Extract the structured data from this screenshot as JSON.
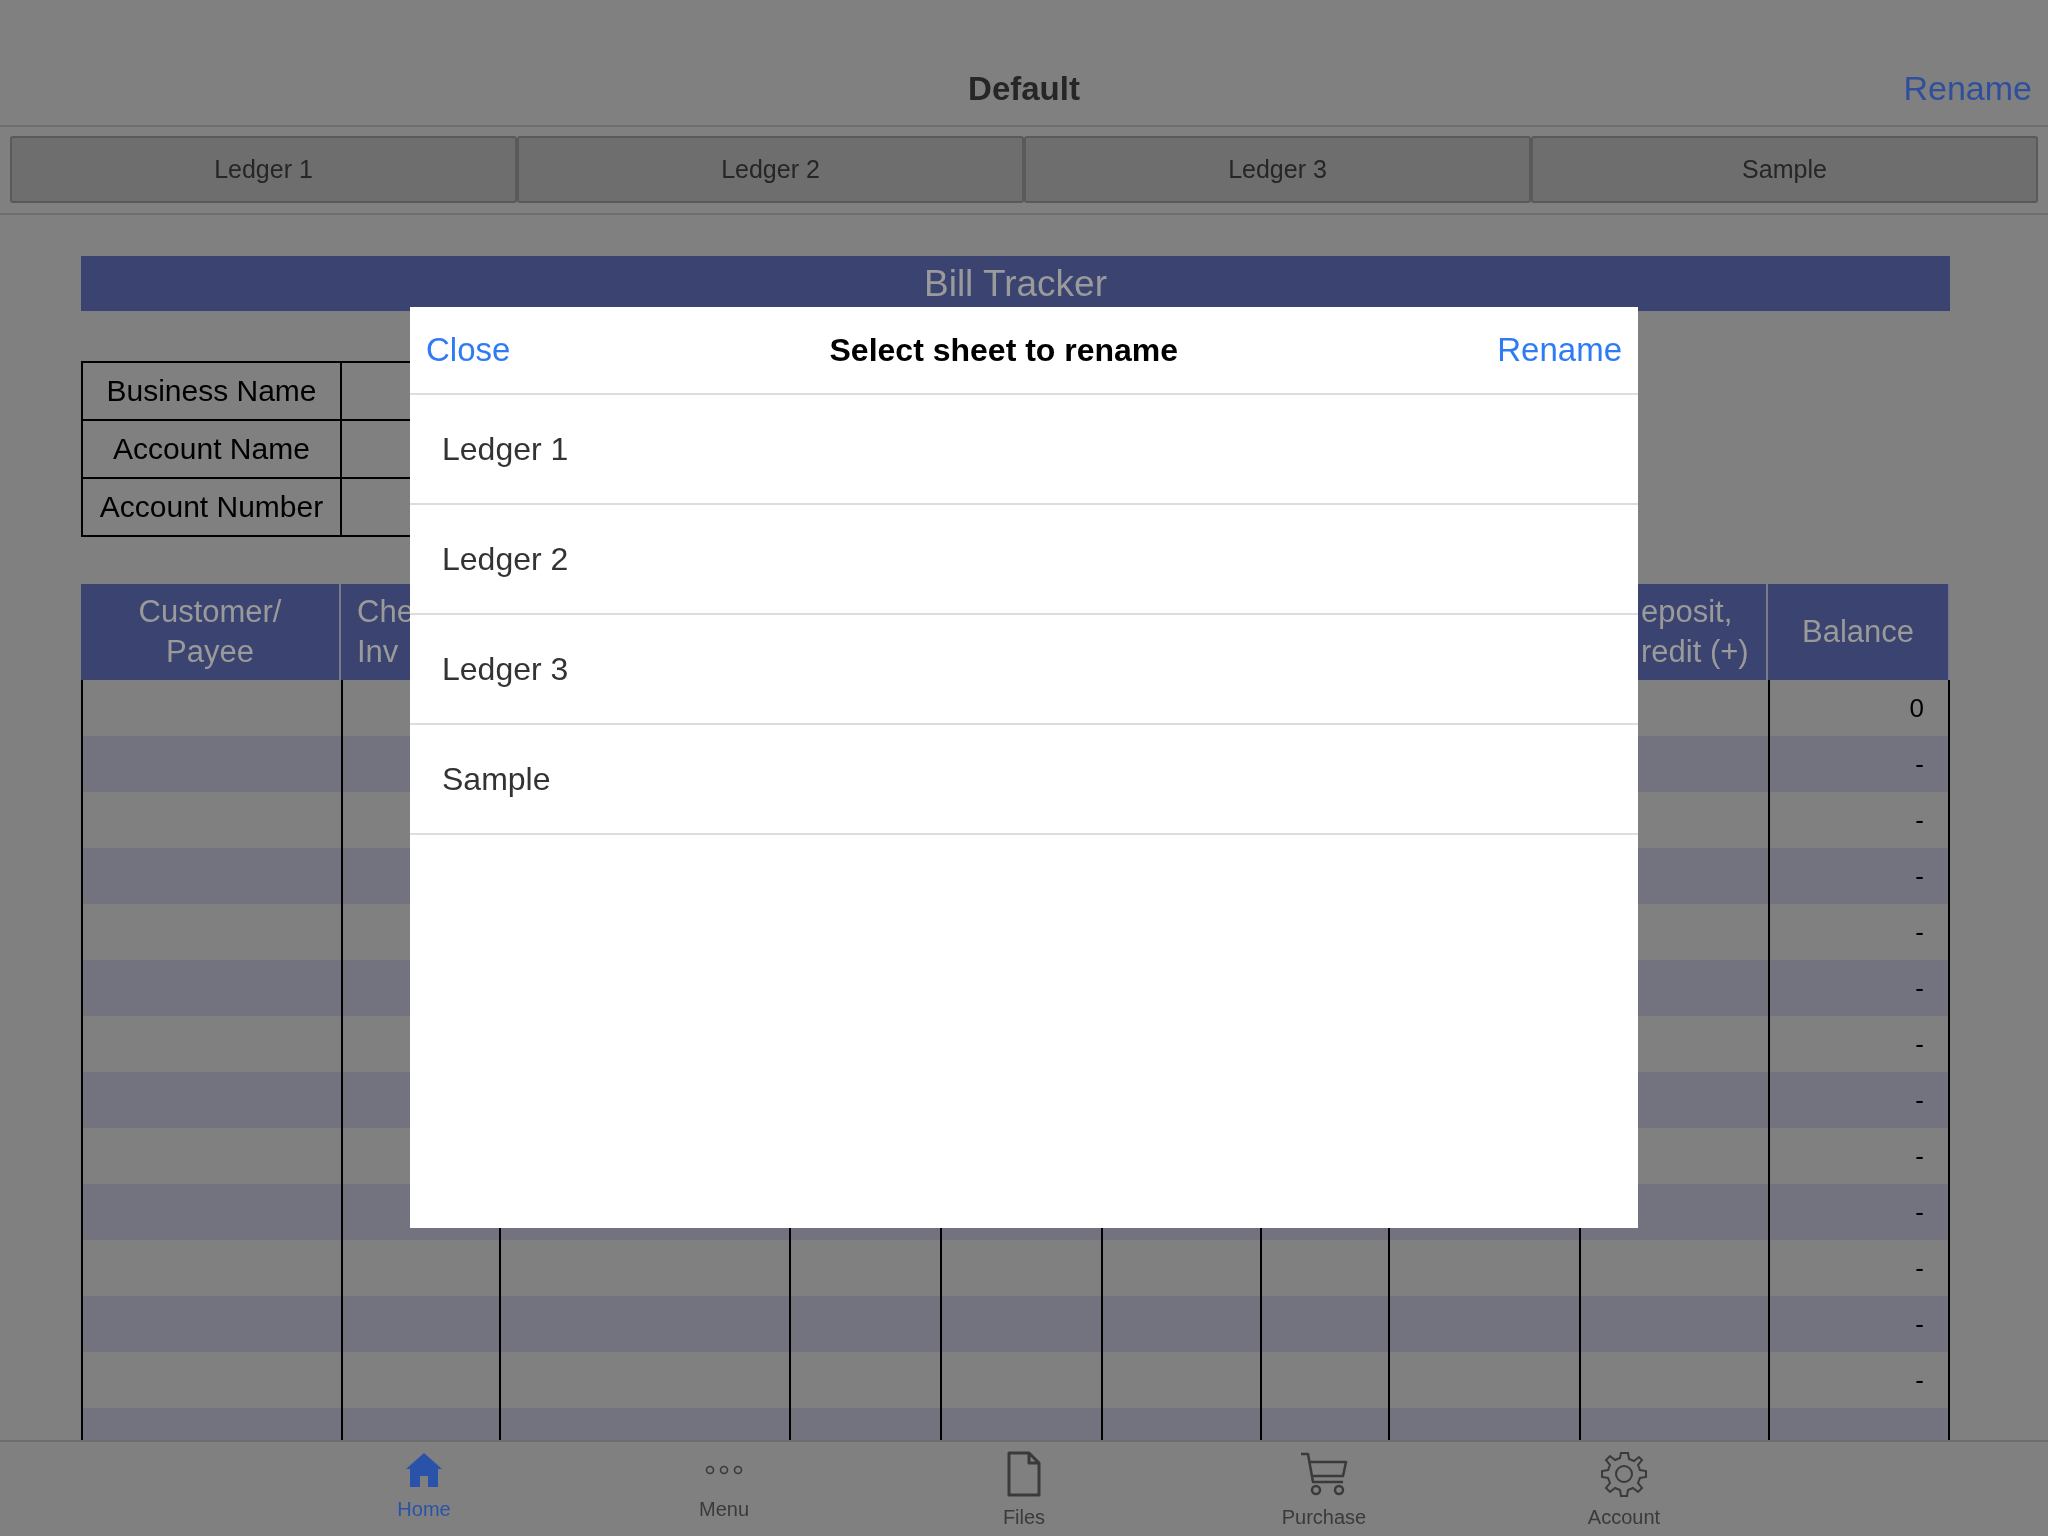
{
  "header": {
    "title": "Default",
    "action": "Rename"
  },
  "sheet_tabs": [
    {
      "label": "Ledger 1",
      "selected": false
    },
    {
      "label": "Ledger 2",
      "selected": false
    },
    {
      "label": "Ledger 3",
      "selected": false
    },
    {
      "label": "Sample",
      "selected": false
    }
  ],
  "sheet": {
    "title": "Bill Tracker",
    "info_labels": [
      "Business Name",
      "Account Name",
      "Account Number"
    ],
    "column_headers": [
      {
        "lines": [
          "Customer/",
          "Payee"
        ]
      },
      {
        "lines": [
          "Che",
          "Inv"
        ]
      },
      {
        "lines": [
          "eposit,",
          "redit (+)"
        ]
      },
      {
        "lines": [
          "Balance"
        ]
      }
    ],
    "balances": [
      "0",
      "-",
      "-",
      "-",
      "-",
      "-",
      "-",
      "-",
      "-",
      "-",
      "-",
      "-",
      "-"
    ]
  },
  "dialog": {
    "close": "Close",
    "title": "Select sheet to rename",
    "action": "Rename",
    "items": [
      "Ledger 1",
      "Ledger 2",
      "Ledger 3",
      "Sample"
    ]
  },
  "tab_bar": [
    {
      "label": "Home",
      "selected": true
    },
    {
      "label": "Menu",
      "selected": false
    },
    {
      "label": "Files",
      "selected": false
    },
    {
      "label": "Purchase",
      "selected": false
    },
    {
      "label": "Account",
      "selected": false
    }
  ]
}
